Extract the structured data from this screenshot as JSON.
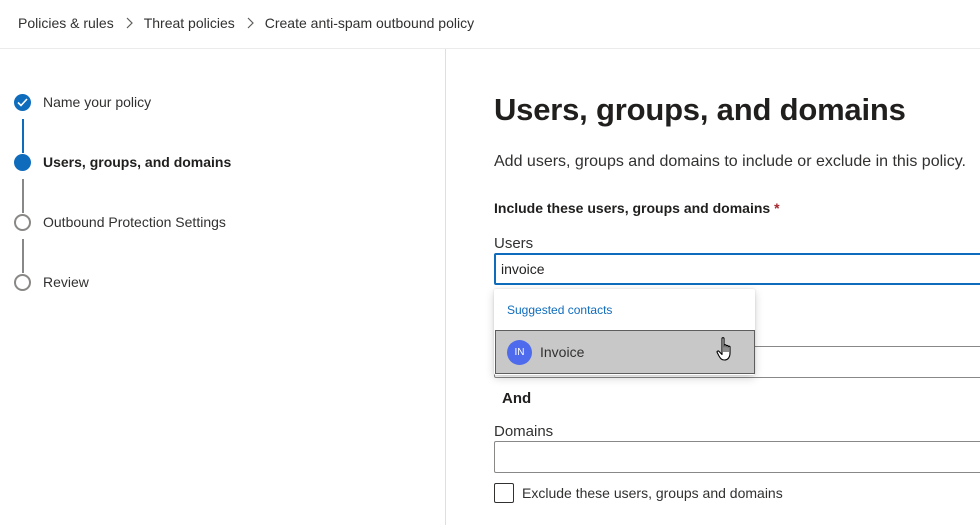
{
  "breadcrumb": {
    "items": [
      "Policies & rules",
      "Threat policies"
    ],
    "current": "Create anti-spam outbound policy"
  },
  "steps": [
    {
      "label": "Name your policy",
      "state": "done"
    },
    {
      "label": "Users, groups, and domains",
      "state": "current"
    },
    {
      "label": "Outbound Protection Settings",
      "state": "todo"
    },
    {
      "label": "Review",
      "state": "todo"
    }
  ],
  "main": {
    "title": "Users, groups, and domains",
    "description": "Add users, groups and domains to include or exclude in this policy.",
    "include_label": "Include these users, groups and domains",
    "required_mark": "*",
    "users_label": "Users",
    "users_value": "invoice",
    "groups_value": "",
    "and_label": "And",
    "domains_label": "Domains",
    "domains_value": "",
    "exclude_label": "Exclude these users, groups and domains"
  },
  "suggestions": {
    "header": "Suggested contacts",
    "items": [
      {
        "initials": "IN",
        "name": "Invoice"
      }
    ]
  },
  "colors": {
    "accent": "#0f6cbd",
    "avatar": "#4f6bed",
    "required": "#a4262c"
  }
}
